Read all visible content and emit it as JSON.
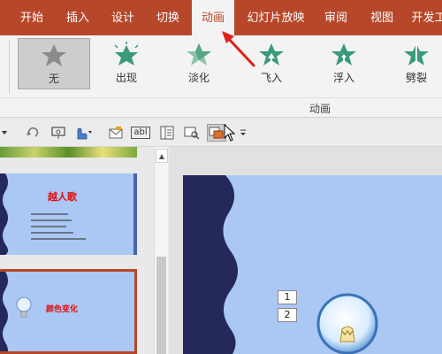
{
  "tabs": [
    {
      "label": "开始"
    },
    {
      "label": "插入"
    },
    {
      "label": "设计"
    },
    {
      "label": "切换"
    },
    {
      "label": "动画"
    },
    {
      "label": "幻灯片放映"
    },
    {
      "label": "审阅"
    },
    {
      "label": "视图"
    },
    {
      "label": "开发工"
    }
  ],
  "active_tab": "动画",
  "animations": [
    {
      "label": "无",
      "icon": "star-none-icon",
      "selected": true
    },
    {
      "label": "出现",
      "icon": "appear-star-icon"
    },
    {
      "label": "淡化",
      "icon": "fade-star-icon"
    },
    {
      "label": "飞入",
      "icon": "fly-in-star-icon"
    },
    {
      "label": "浮入",
      "icon": "float-in-star-icon"
    },
    {
      "label": "劈裂",
      "icon": "split-star-icon"
    }
  ],
  "ribbon_group_label": "动画",
  "qat": {
    "text_field_label": "abl"
  },
  "thumbnails": [
    {
      "title": "越人歌"
    },
    {
      "title": "颜色变化"
    }
  ],
  "slide_tags": [
    "1",
    "2"
  ],
  "colors": {
    "accent": "#b7472a",
    "star_gray": "#8a8a8a",
    "star_green": "#3a9a7a",
    "slide_bg": "#aac8f3",
    "slide_wave": "#24295a"
  }
}
